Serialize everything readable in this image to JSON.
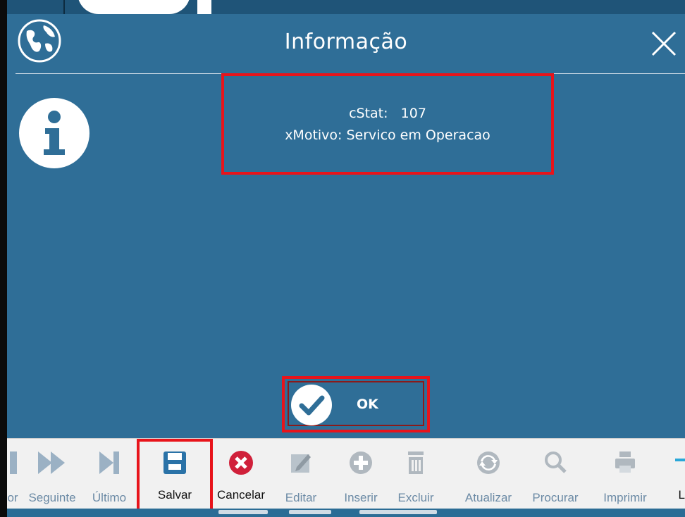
{
  "dialog": {
    "title": "Informação",
    "message_line1": "cStat:   107",
    "message_line2": "xMotivo: Servico em Operacao",
    "ok_label": "OK"
  },
  "toolbar": {
    "items": [
      {
        "label": "or",
        "icon": "prev-icon"
      },
      {
        "label": "Seguinte",
        "icon": "next-icon"
      },
      {
        "label": "Último",
        "icon": "last-icon"
      },
      {
        "label": "Salvar",
        "icon": "save-icon"
      },
      {
        "label": "Cancelar",
        "icon": "cancel-icon"
      },
      {
        "label": "Editar",
        "icon": "edit-icon"
      },
      {
        "label": "Inserir",
        "icon": "add-icon"
      },
      {
        "label": "Excluir",
        "icon": "trash-icon"
      },
      {
        "label": "Atualizar",
        "icon": "refresh-icon"
      },
      {
        "label": "Procurar",
        "icon": "search-icon"
      },
      {
        "label": "Imprimir",
        "icon": "print-icon"
      },
      {
        "label": "L",
        "icon": "partial-icon"
      }
    ]
  },
  "colors": {
    "dialog_bg": "#2f6e97",
    "highlight": "#e8141b",
    "toolbar_bg": "#f1f1f1",
    "disabled_text": "#6b8aa5"
  }
}
